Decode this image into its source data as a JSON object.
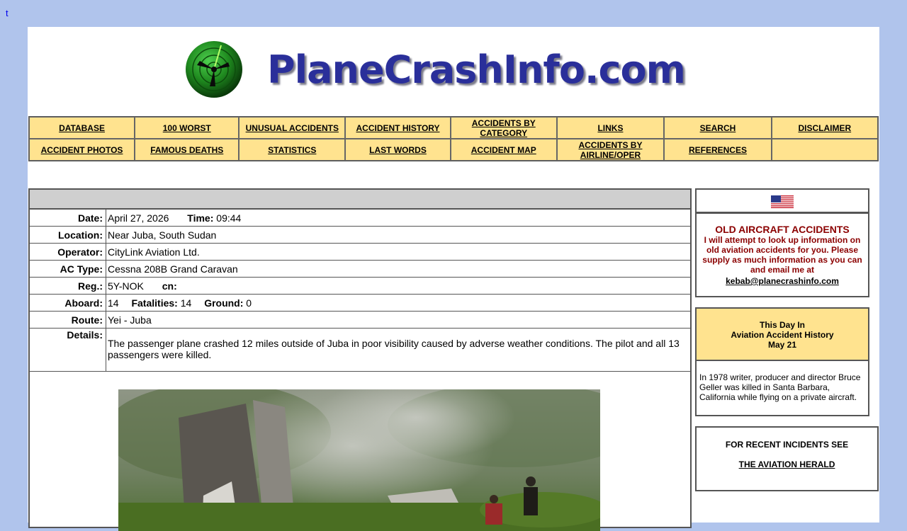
{
  "corner_link": "t",
  "logo": {
    "text": "PlaneCrashInfo.com"
  },
  "nav": {
    "row1": [
      "DATABASE",
      "100 WORST",
      "UNUSUAL ACCIDENTS",
      "ACCIDENT HISTORY",
      "ACCIDENTS BY CATEGORY",
      "LINKS",
      "SEARCH",
      "DISCLAIMER"
    ],
    "row2": [
      "ACCIDENT PHOTOS",
      "FAMOUS DEATHS",
      "STATISTICS",
      "LAST WORDS",
      "ACCIDENT MAP",
      "ACCIDENTS BY AIRLINE/OPER",
      "REFERENCES",
      ""
    ]
  },
  "accident": {
    "labels": {
      "date": "Date:",
      "time": "Time:",
      "location": "Location:",
      "operator": "Operator:",
      "ac_type": "AC Type:",
      "reg": "Reg.:",
      "cn": "cn:",
      "aboard": "Aboard:",
      "fatalities": "Fatalities:",
      "ground": "Ground:",
      "route": "Route:",
      "details": "Details:"
    },
    "date": "April 27, 2026",
    "time": "09:44",
    "location": "Near Juba, South Sudan",
    "operator": "CityLink Aviation Ltd.",
    "ac_type": "Cessna 208B Grand Caravan",
    "reg": "5Y-NOK",
    "cn": "",
    "aboard": "14",
    "fatalities": "14",
    "ground": "0",
    "route": "Yei - Juba",
    "details": "The passenger plane crashed 12 miles outside of Juba in poor visibility caused by adverse weather conditions. The pilot and all 13 passengers were killed."
  },
  "old_aircraft": {
    "title": "OLD AIRCRAFT ACCIDENTS",
    "text": "I will attempt to look up information on old aviation accidents for you. Please supply as much information as you can and email me at",
    "email": "kebab@planecrashinfo.com"
  },
  "this_day": {
    "line1": "This Day In",
    "line2": "Aviation Accident History",
    "line3": "May 21",
    "text": "In 1978 writer, producer and director Bruce Geller was killed in Santa Barbara, California while flying on a private aircraft."
  },
  "recent": {
    "text": "FOR RECENT INCIDENTS SEE",
    "link": "THE AVIATION HERALD"
  },
  "colors": {
    "background": "#b0c4ec",
    "nav_cell": "#ffe38f",
    "logo_text": "#2a2f9a",
    "old_accidents_text": "#8b0000"
  }
}
